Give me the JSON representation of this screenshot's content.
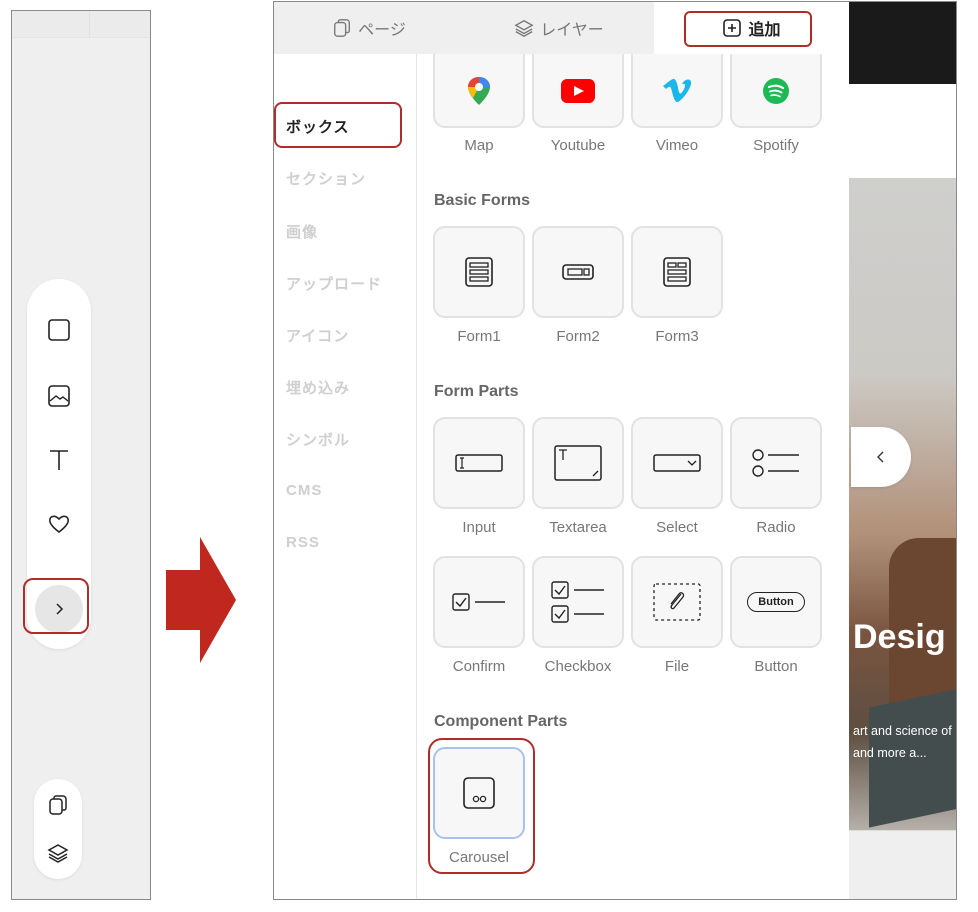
{
  "left_toolbar": {
    "tools": [
      {
        "icon": "square-box-icon"
      },
      {
        "icon": "image-icon"
      },
      {
        "icon": "text-icon"
      },
      {
        "icon": "heart-icon"
      }
    ],
    "expand_icon": "chevron-right-icon",
    "page_icon": "pages-icon",
    "layer_icon": "layers-icon"
  },
  "tabs": [
    {
      "label": "ページ",
      "icon": "pages-icon",
      "active": false
    },
    {
      "label": "レイヤー",
      "icon": "layers-icon",
      "active": false
    },
    {
      "label": "追加",
      "icon": "plus-box-icon",
      "active": true
    }
  ],
  "categories": [
    {
      "label": "ボックス",
      "active": true
    },
    {
      "label": "セクション"
    },
    {
      "label": "画像"
    },
    {
      "label": "アップロード"
    },
    {
      "label": "アイコン"
    },
    {
      "label": "埋め込み"
    },
    {
      "label": "シンボル"
    },
    {
      "label": "CMS"
    },
    {
      "label": "RSS"
    }
  ],
  "embeds": {
    "items": [
      {
        "label": "Map",
        "icon": "map-pin-icon"
      },
      {
        "label": "Youtube",
        "icon": "youtube-icon"
      },
      {
        "label": "Vimeo",
        "icon": "vimeo-icon"
      },
      {
        "label": "Spotify",
        "icon": "spotify-icon"
      }
    ]
  },
  "basic_forms": {
    "title": "Basic Forms",
    "items": [
      {
        "label": "Form1",
        "icon": "form1-icon"
      },
      {
        "label": "Form2",
        "icon": "form2-icon"
      },
      {
        "label": "Form3",
        "icon": "form3-icon"
      }
    ]
  },
  "form_parts": {
    "title": "Form Parts",
    "items": [
      {
        "label": "Input",
        "icon": "input-field-icon"
      },
      {
        "label": "Textarea",
        "icon": "textarea-icon"
      },
      {
        "label": "Select",
        "icon": "select-dropdown-icon"
      },
      {
        "label": "Radio",
        "icon": "radio-icon"
      },
      {
        "label": "Confirm",
        "icon": "confirm-checkbox-icon"
      },
      {
        "label": "Checkbox",
        "icon": "checkbox-list-icon"
      },
      {
        "label": "File",
        "icon": "file-attach-icon"
      },
      {
        "label": "Button",
        "icon": "button-icon",
        "inner_text": "Button"
      }
    ]
  },
  "component_parts": {
    "title": "Component Parts",
    "items": [
      {
        "label": "Carousel",
        "icon": "carousel-icon",
        "selected": true
      }
    ]
  },
  "preview": {
    "heading": "Desig",
    "text_line1": "art and science of",
    "text_line2": "and more a..."
  },
  "colors": {
    "highlight": "#b02e2a",
    "arrow": "#c0281f",
    "selected_border": "#a9c1ee"
  }
}
